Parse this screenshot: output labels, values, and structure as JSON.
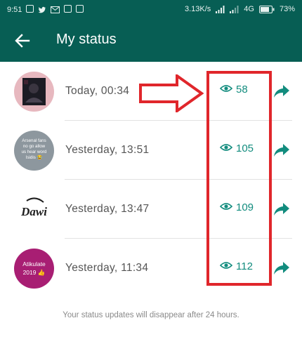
{
  "status_bar": {
    "time": "9:51",
    "speed": "3.13K/s",
    "network": "4G",
    "battery": "73%"
  },
  "app_bar": {
    "title": "My status",
    "back_icon": "arrow-left-icon"
  },
  "statuses": [
    {
      "time": "Today, 00:34",
      "views": "58",
      "avatar": {
        "kind": "photo",
        "bg": "#e7b8bf"
      }
    },
    {
      "time": "Yesterday, 13:51",
      "views": "105",
      "avatar": {
        "kind": "text",
        "bg": "#8d979e",
        "text": "Arsenal fans no go allow us hear word Isidis 😂"
      }
    },
    {
      "time": "Yesterday, 13:47",
      "views": "109",
      "avatar": {
        "kind": "logo",
        "bg": "#ffffff",
        "text": "Dawi"
      }
    },
    {
      "time": "Yesterday, 11:34",
      "views": "112",
      "avatar": {
        "kind": "text",
        "bg": "#a81e73",
        "text": "Atikulate 2019 👍"
      }
    }
  ],
  "footer_note": "Your status updates will disappear after 24 hours.",
  "colors": {
    "header": "#075e54",
    "accent": "#128c7e",
    "annotation": "#e0262b"
  }
}
